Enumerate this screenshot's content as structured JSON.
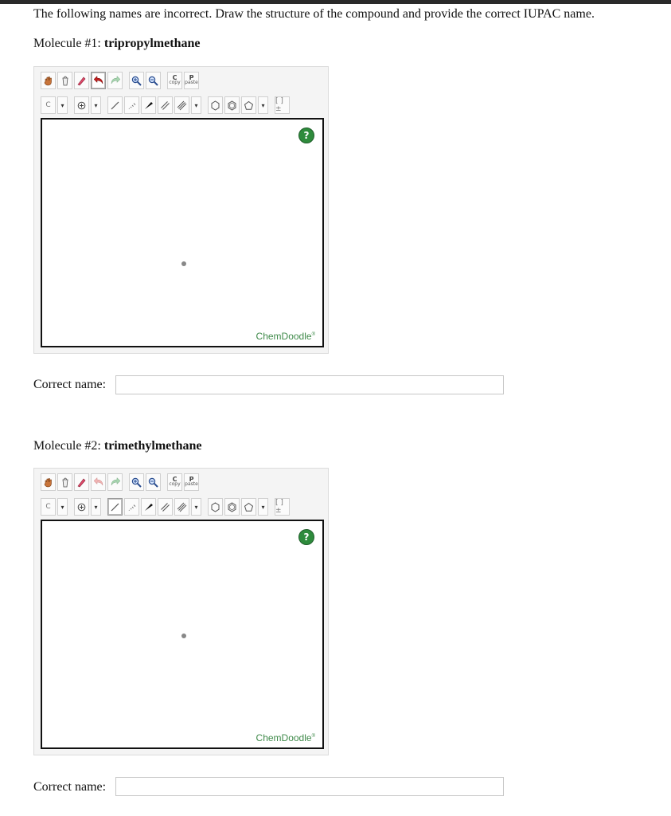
{
  "instructions": "The following names are incorrect. Draw the structure of the compound and provide the correct IUPAC name.",
  "molecules": [
    {
      "label": "Molecule #1:",
      "name": "tripropylmethane",
      "selected_tool": "eraser",
      "canvas": {
        "help_label": "?",
        "brand": "ChemDoodle",
        "brand_mark": "®"
      },
      "answer": {
        "label": "Correct name:",
        "value": "",
        "placeholder": ""
      }
    },
    {
      "label": "Molecule #2:",
      "name": "trimethylmethane",
      "selected_tool": "single-bond",
      "canvas": {
        "help_label": "?",
        "brand": "ChemDoodle",
        "brand_mark": "®"
      },
      "answer": {
        "label": "Correct name:",
        "value": "",
        "placeholder": ""
      }
    }
  ],
  "toolbar": {
    "copy_label": "copy",
    "copy_letter": "C",
    "paste_label": "paste",
    "paste_letter": "P",
    "atom_label": "C",
    "label_tool": "[ ]±",
    "dropdown_glyph": "▾"
  },
  "colors": {
    "brand": "#3f8a4a",
    "help": "#2e8b3c",
    "canvas_border": "#111111"
  }
}
